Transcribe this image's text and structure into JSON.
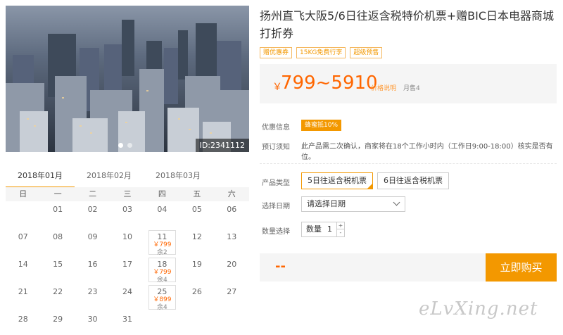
{
  "photo": {
    "id_label": "ID:2341112",
    "alt": "city-skyline-photo"
  },
  "calendar": {
    "tabs": [
      "2018年01月",
      "2018年02月",
      "2018年03月"
    ],
    "weekdays": [
      "日",
      "一",
      "二",
      "三",
      "四",
      "五",
      "六"
    ],
    "weeks": [
      [
        {
          "d": ""
        },
        {
          "d": "01"
        },
        {
          "d": "02"
        },
        {
          "d": "03"
        },
        {
          "d": "04"
        },
        {
          "d": "05"
        },
        {
          "d": "06"
        }
      ],
      [
        {
          "d": "07"
        },
        {
          "d": "08"
        },
        {
          "d": "09"
        },
        {
          "d": "10"
        },
        {
          "d": "11",
          "price": "￥799",
          "rem": "余2"
        },
        {
          "d": "12"
        },
        {
          "d": "13"
        }
      ],
      [
        {
          "d": "14"
        },
        {
          "d": "15"
        },
        {
          "d": "16"
        },
        {
          "d": "17"
        },
        {
          "d": "18",
          "price": "￥799",
          "rem": "余4"
        },
        {
          "d": "19"
        },
        {
          "d": "20"
        }
      ],
      [
        {
          "d": "21"
        },
        {
          "d": "22"
        },
        {
          "d": "23"
        },
        {
          "d": "24"
        },
        {
          "d": "25",
          "price": "￥899",
          "rem": "余4"
        },
        {
          "d": "26"
        },
        {
          "d": "27"
        }
      ],
      [
        {
          "d": "28"
        },
        {
          "d": "29"
        },
        {
          "d": "30"
        },
        {
          "d": "31"
        },
        {
          "d": ""
        },
        {
          "d": ""
        },
        {
          "d": ""
        }
      ]
    ]
  },
  "product": {
    "title": "扬州直飞大阪5/6日往返含税特价机票+赠BIC日本电器商城打折券",
    "tags": [
      "赠优惠券",
      "15KG免费行李",
      "超级预售"
    ],
    "price_symbol": "￥",
    "price_range": "799~5910",
    "price_explain": "价格说明",
    "monthly_sales": "月售4"
  },
  "info": {
    "promo_label": "优惠信息",
    "promo_badge": "蜂蜜抵10%",
    "notice_label": "预订须知",
    "notice_text": "此产品需二次确认，商家将在18个工作小时内（工作日9:00-18:00）核实是否有位。"
  },
  "options": {
    "type_label": "产品类型",
    "types": [
      "5日往返含税机票",
      "6日往返含税机票"
    ],
    "date_label": "选择日期",
    "date_placeholder": "请选择日期",
    "qty_label": "数量选择",
    "qty_text": "数量",
    "qty_value": "1"
  },
  "buy": {
    "total": "--",
    "button": "立即购买"
  },
  "watermark": "eLvXing.net",
  "colors": {
    "accent": "#f39800",
    "price": "#ff6600"
  }
}
